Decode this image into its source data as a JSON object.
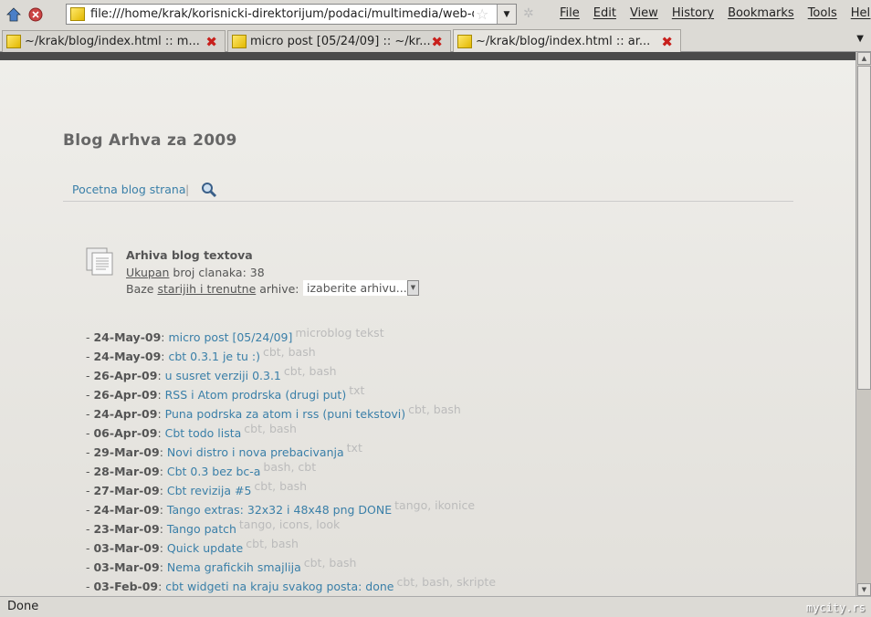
{
  "browser": {
    "url": "file:///home/krak/korisnicki-direktorijum/podaci/multimedia/web-di:",
    "menu": [
      "File",
      "Edit",
      "View",
      "History",
      "Bookmarks",
      "Tools",
      "Help"
    ],
    "tabs": [
      {
        "label": "~/krak/blog/index.html :: m...",
        "active": false
      },
      {
        "label": "micro post [05/24/09] :: ~/kr...",
        "active": false
      },
      {
        "label": "~/krak/blog/index.html :: ar...",
        "active": true
      }
    ],
    "status": "Done",
    "watermark": "mycity.rs"
  },
  "page": {
    "title": "Blog Arhva za 2009",
    "nav_home": "Pocetna blog strana",
    "nav_sep": "|",
    "archive": {
      "title": "Arhiva blog textova",
      "count_u": "Ukupan",
      "count_rest": " broj clanaka: 38",
      "base_pre": "Baze ",
      "base_u": "starijih i trenutne",
      "base_post": " arhive:",
      "select_value": "izaberite arhivu..."
    },
    "posts": [
      {
        "date": "24-May-09",
        "title": "micro post [05/24/09]",
        "tags": "microblog tekst"
      },
      {
        "date": "24-May-09",
        "title": "cbt 0.3.1 je tu :)",
        "tags": "cbt, bash"
      },
      {
        "date": "26-Apr-09",
        "title": "u susret verziji 0.3.1",
        "tags": "cbt, bash"
      },
      {
        "date": "26-Apr-09",
        "title": "RSS i Atom prodrska (drugi put)",
        "tags": "txt"
      },
      {
        "date": "24-Apr-09",
        "title": "Puna podrska za atom i rss (puni tekstovi)",
        "tags": "cbt, bash"
      },
      {
        "date": "06-Apr-09",
        "title": "Cbt todo lista",
        "tags": "cbt, bash"
      },
      {
        "date": "29-Mar-09",
        "title": "Novi distro i nova prebacivanja",
        "tags": "txt"
      },
      {
        "date": "28-Mar-09",
        "title": "Cbt 0.3 bez bc-a",
        "tags": "bash, cbt"
      },
      {
        "date": "27-Mar-09",
        "title": "Cbt revizija #5",
        "tags": "cbt, bash"
      },
      {
        "date": "24-Mar-09",
        "title": "Tango extras: 32x32 i 48x48 png DONE",
        "tags": "tango, ikonice"
      },
      {
        "date": "23-Mar-09",
        "title": "Tango patch",
        "tags": "tango, icons, look"
      },
      {
        "date": "03-Mar-09",
        "title": "Quick update",
        "tags": "cbt, bash"
      },
      {
        "date": "03-Mar-09",
        "title": "Nema grafickih smajlija",
        "tags": "cbt, bash"
      },
      {
        "date": "03-Feb-09",
        "title": "cbt widgeti na kraju svakog posta: done",
        "tags": "cbt, bash, skripte"
      }
    ]
  }
}
